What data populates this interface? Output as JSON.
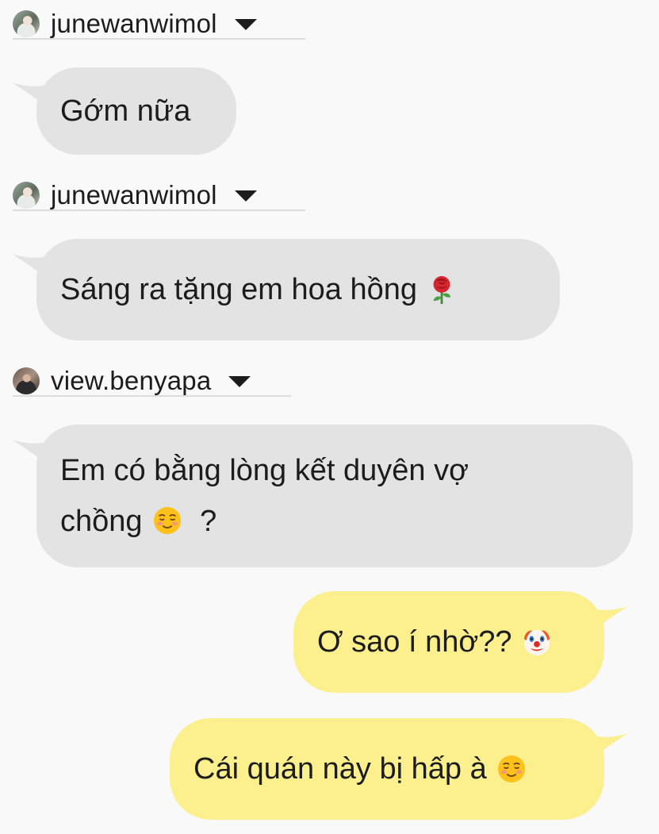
{
  "messages": [
    {
      "sender": "junewanwimol",
      "direction": "incoming",
      "text": "Gớm nữa"
    },
    {
      "sender": "junewanwimol",
      "direction": "incoming",
      "text": "Sáng ra tặng em hoa hồng",
      "emoji": "rose-icon"
    },
    {
      "sender": "view.benyapa",
      "direction": "incoming",
      "line1": "Em có bằng lòng kết duyên vợ",
      "line2a": "chồng",
      "emoji": "smiling-face-icon",
      "line2b": "?"
    },
    {
      "direction": "outgoing",
      "text": "Ơ sao í nhờ??",
      "emoji": "clown-face-icon"
    },
    {
      "direction": "outgoing",
      "text": "Cái quán này bị hấp à",
      "emoji": "smiling-face-icon"
    }
  ],
  "colors": {
    "background": "#f9f9f9",
    "incoming_bubble": "#e3e3e3",
    "outgoing_bubble": "#fbf08d",
    "divider": "#dcdcdc"
  }
}
